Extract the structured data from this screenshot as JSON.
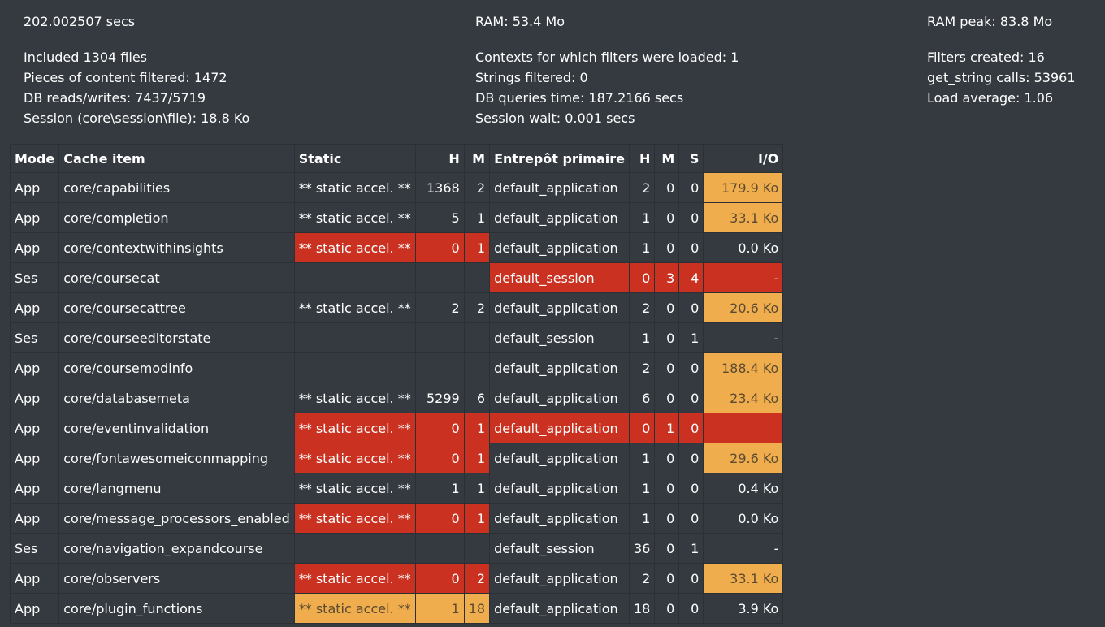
{
  "stats": {
    "col1": {
      "head": "202.002507 secs",
      "lines": [
        "Included 1304 files",
        "Pieces of content filtered: 1472",
        "DB reads/writes: 7437/5719",
        "Session (core\\session\\file): 18.8 Ko"
      ]
    },
    "col2": {
      "head": "RAM: 53.4 Mo",
      "lines": [
        "Contexts for which filters were loaded: 1",
        "Strings filtered: 0",
        "DB queries time: 187.2166 secs",
        "Session wait: 0.001 secs"
      ]
    },
    "col3": {
      "head": "RAM peak: 83.8 Mo",
      "lines": [
        "Filters created: 16",
        "get_string calls: 53961",
        "Load average: 1.06"
      ]
    }
  },
  "table": {
    "headers": {
      "mode": "Mode",
      "item": "Cache item",
      "static": "Static",
      "sh": "H",
      "sm": "M",
      "store": "Entrepôt primaire",
      "h": "H",
      "m": "M",
      "s": "S",
      "io": "I/O"
    },
    "colors": {
      "bad": "#ca3120",
      "warn": "#f0ad4e",
      "background": "#343a40"
    },
    "rows": [
      {
        "mode": "App",
        "item": "core/capabilities",
        "static": "** static accel. **",
        "sh": "1368",
        "sm": "2",
        "store": "default_application",
        "h": "2",
        "m": "0",
        "s": "0",
        "io": "179.9 Ko",
        "static_state": "",
        "store_state": "",
        "io_state": "warn"
      },
      {
        "mode": "App",
        "item": "core/completion",
        "static": "** static accel. **",
        "sh": "5",
        "sm": "1",
        "store": "default_application",
        "h": "1",
        "m": "0",
        "s": "0",
        "io": "33.1 Ko",
        "static_state": "",
        "store_state": "",
        "io_state": "warn"
      },
      {
        "mode": "App",
        "item": "core/contextwithinsights",
        "static": "** static accel. **",
        "sh": "0",
        "sm": "1",
        "store": "default_application",
        "h": "1",
        "m": "0",
        "s": "0",
        "io": "0.0 Ko",
        "static_state": "bad",
        "store_state": "",
        "io_state": ""
      },
      {
        "mode": "Ses",
        "item": "core/coursecat",
        "static": "",
        "sh": "",
        "sm": "",
        "store": "default_session",
        "h": "0",
        "m": "3",
        "s": "4",
        "io": "-",
        "static_state": "",
        "store_state": "bad",
        "io_state": "bad"
      },
      {
        "mode": "App",
        "item": "core/coursecattree",
        "static": "** static accel. **",
        "sh": "2",
        "sm": "2",
        "store": "default_application",
        "h": "2",
        "m": "0",
        "s": "0",
        "io": "20.6 Ko",
        "static_state": "",
        "store_state": "",
        "io_state": "warn"
      },
      {
        "mode": "Ses",
        "item": "core/courseeditorstate",
        "static": "",
        "sh": "",
        "sm": "",
        "store": "default_session",
        "h": "1",
        "m": "0",
        "s": "1",
        "io": "-",
        "static_state": "",
        "store_state": "",
        "io_state": ""
      },
      {
        "mode": "App",
        "item": "core/coursemodinfo",
        "static": "",
        "sh": "",
        "sm": "",
        "store": "default_application",
        "h": "2",
        "m": "0",
        "s": "0",
        "io": "188.4 Ko",
        "static_state": "",
        "store_state": "",
        "io_state": "warn"
      },
      {
        "mode": "App",
        "item": "core/databasemeta",
        "static": "** static accel. **",
        "sh": "5299",
        "sm": "6",
        "store": "default_application",
        "h": "6",
        "m": "0",
        "s": "0",
        "io": "23.4 Ko",
        "static_state": "",
        "store_state": "",
        "io_state": "warn"
      },
      {
        "mode": "App",
        "item": "core/eventinvalidation",
        "static": "** static accel. **",
        "sh": "0",
        "sm": "1",
        "store": "default_application",
        "h": "0",
        "m": "1",
        "s": "0",
        "io": "",
        "static_state": "bad",
        "store_state": "bad",
        "io_state": "bad"
      },
      {
        "mode": "App",
        "item": "core/fontawesomeiconmapping",
        "static": "** static accel. **",
        "sh": "0",
        "sm": "1",
        "store": "default_application",
        "h": "1",
        "m": "0",
        "s": "0",
        "io": "29.6 Ko",
        "static_state": "bad",
        "store_state": "",
        "io_state": "warn"
      },
      {
        "mode": "App",
        "item": "core/langmenu",
        "static": "** static accel. **",
        "sh": "1",
        "sm": "1",
        "store": "default_application",
        "h": "1",
        "m": "0",
        "s": "0",
        "io": "0.4 Ko",
        "static_state": "",
        "store_state": "",
        "io_state": ""
      },
      {
        "mode": "App",
        "item": "core/message_processors_enabled",
        "static": "** static accel. **",
        "sh": "0",
        "sm": "1",
        "store": "default_application",
        "h": "1",
        "m": "0",
        "s": "0",
        "io": "0.0 Ko",
        "static_state": "bad",
        "store_state": "",
        "io_state": ""
      },
      {
        "mode": "Ses",
        "item": "core/navigation_expandcourse",
        "static": "",
        "sh": "",
        "sm": "",
        "store": "default_session",
        "h": "36",
        "m": "0",
        "s": "1",
        "io": "-",
        "static_state": "",
        "store_state": "",
        "io_state": ""
      },
      {
        "mode": "App",
        "item": "core/observers",
        "static": "** static accel. **",
        "sh": "0",
        "sm": "2",
        "store": "default_application",
        "h": "2",
        "m": "0",
        "s": "0",
        "io": "33.1 Ko",
        "static_state": "bad",
        "store_state": "",
        "io_state": "warn"
      },
      {
        "mode": "App",
        "item": "core/plugin_functions",
        "static": "** static accel. **",
        "sh": "1",
        "sm": "18",
        "store": "default_application",
        "h": "18",
        "m": "0",
        "s": "0",
        "io": "3.9 Ko",
        "static_state": "warn",
        "store_state": "",
        "io_state": ""
      }
    ]
  }
}
